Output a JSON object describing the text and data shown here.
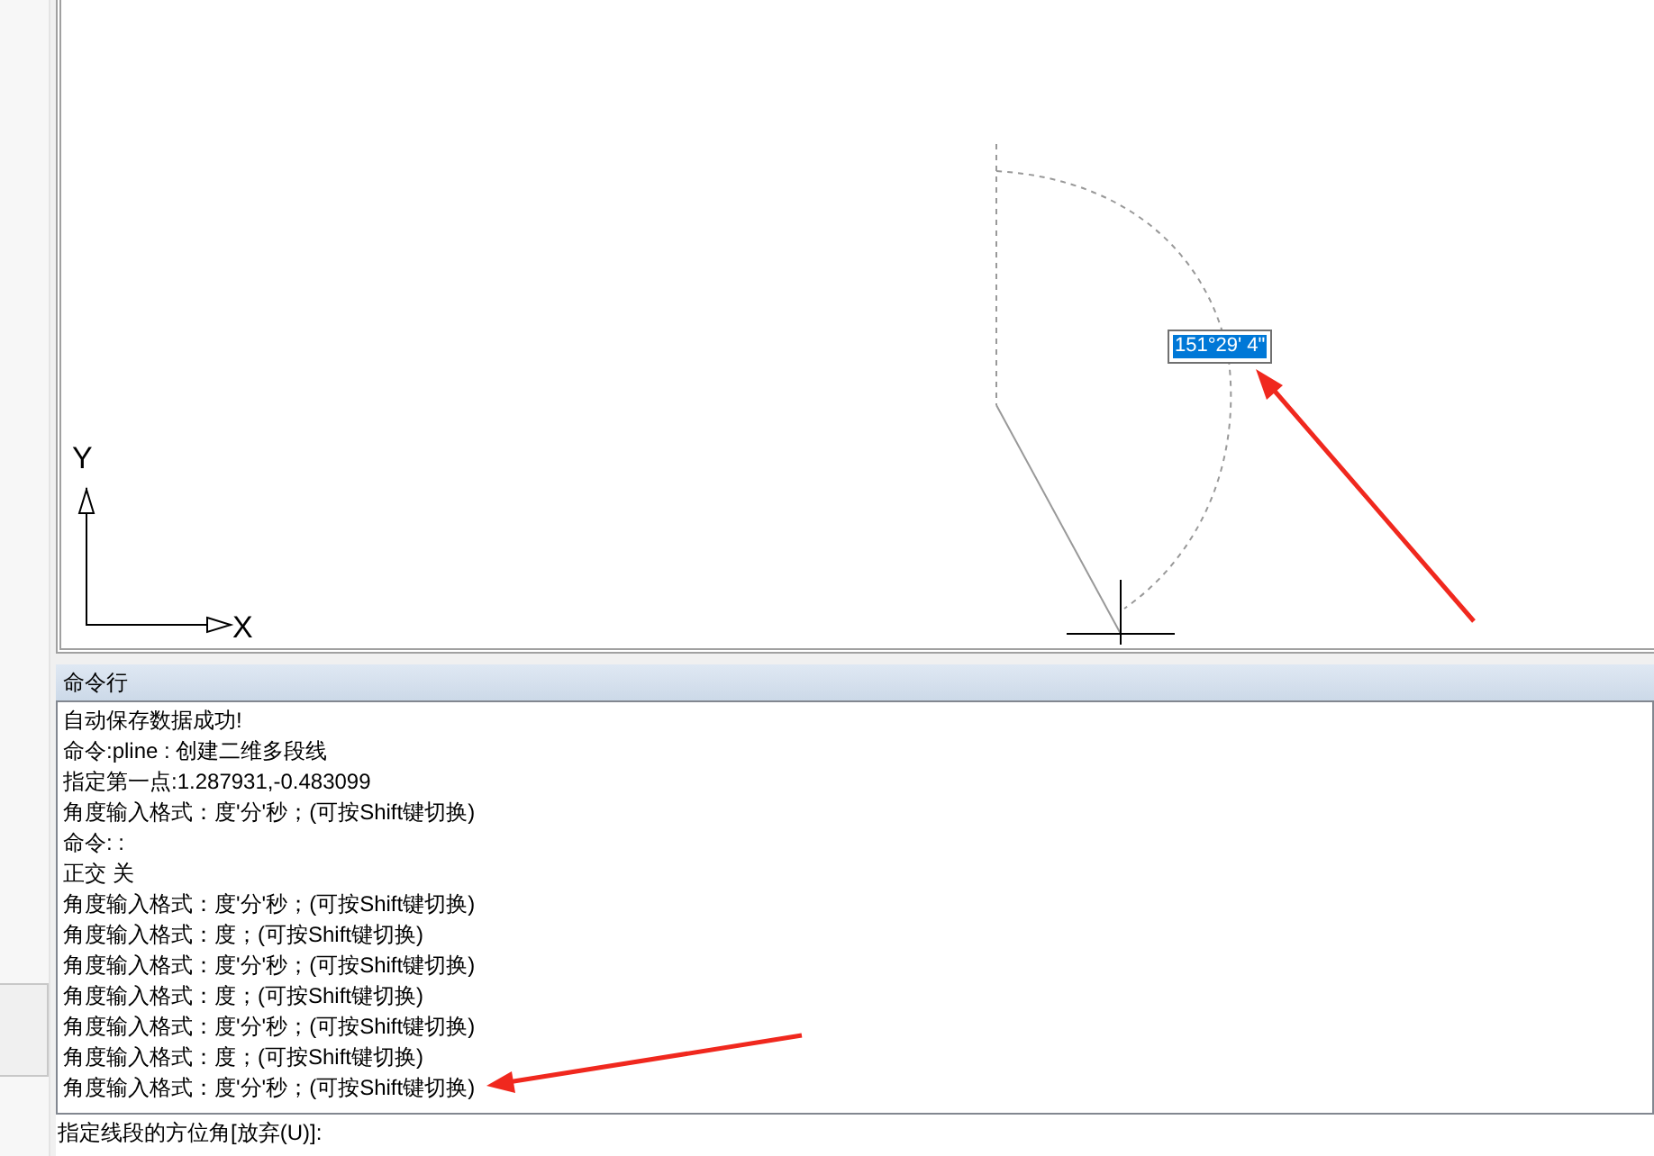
{
  "canvas": {
    "y_axis_label": "Y",
    "x_axis_label": "X",
    "angle_input": "151°29' 4\""
  },
  "command_panel": {
    "title": "命令行",
    "log": [
      "自动保存数据成功!",
      "命令:pline : 创建二维多段线",
      "指定第一点:1.287931,-0.483099",
      "角度输入格式：度'分'秒；(可按Shift键切换)",
      "命令: :",
      "正交 关",
      "角度输入格式：度'分'秒；(可按Shift键切换)",
      "角度输入格式：度；(可按Shift键切换)",
      "角度输入格式：度'分'秒；(可按Shift键切换)",
      "角度输入格式：度；(可按Shift键切换)",
      "角度输入格式：度'分'秒；(可按Shift键切换)",
      "角度输入格式：度；(可按Shift键切换)",
      "角度输入格式：度'分'秒；(可按Shift键切换)"
    ],
    "prompt": "指定线段的方位角[放弃(U)]:"
  }
}
